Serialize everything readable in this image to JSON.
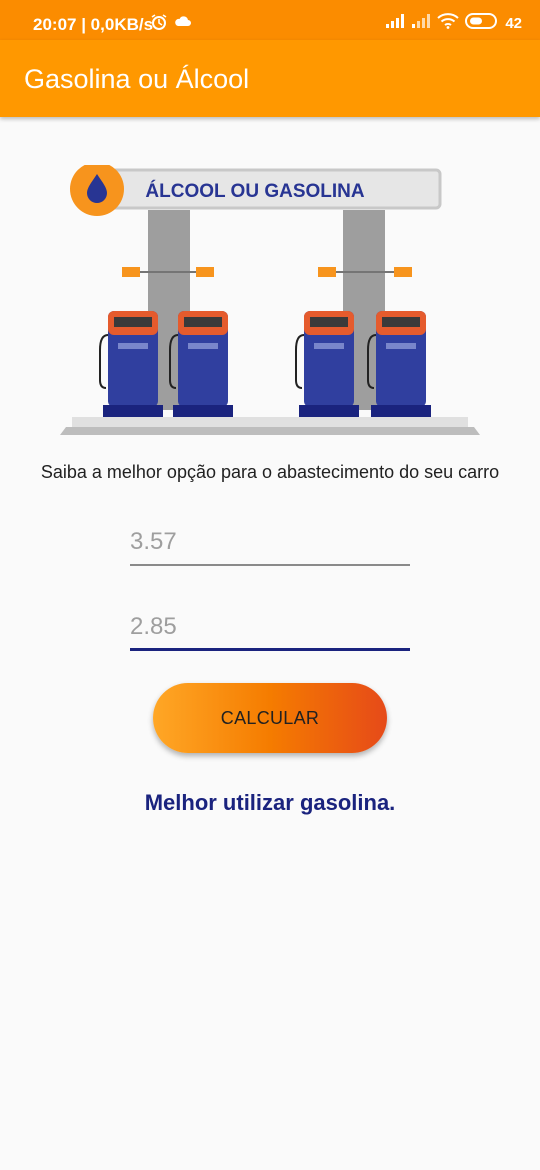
{
  "status": {
    "time": "20:07 | 0,0KB/s",
    "battery": "42"
  },
  "appbar": {
    "title": "Gasolina ou Álcool"
  },
  "hero": {
    "sign_text": "ÁLCOOL OU GASOLINA"
  },
  "subtitle": "Saiba a melhor opção para o abastecimento do seu carro",
  "fields": {
    "gasolina": "3.57",
    "alcool": "2.85"
  },
  "button": {
    "label": "CALCULAR"
  },
  "result": "Melhor utilizar gasolina.",
  "colors": {
    "primary": "#ff9800",
    "accent": "#1a237e"
  }
}
